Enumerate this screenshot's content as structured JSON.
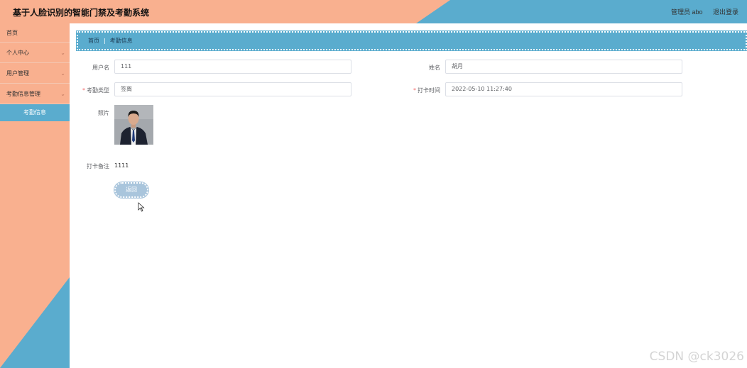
{
  "header": {
    "title": "基于人脸识别的智能门禁及考勤系统",
    "user_label": "管理员 abo",
    "logout_label": "退出登录"
  },
  "sidebar": {
    "items": [
      {
        "label": "首页",
        "has_chevron": false
      },
      {
        "label": "个人中心",
        "has_chevron": true
      },
      {
        "label": "用户管理",
        "has_chevron": true
      },
      {
        "label": "考勤信息管理",
        "has_chevron": true
      }
    ],
    "subitem": {
      "label": "考勤信息"
    }
  },
  "breadcrumb": {
    "home": "首页",
    "separator": "|",
    "current": "考勤信息"
  },
  "form": {
    "username": {
      "label": "用户名",
      "value": "111"
    },
    "name": {
      "label": "姓名",
      "value": "胡月"
    },
    "attendance_type": {
      "label": "考勤类型",
      "value": "签离",
      "required_mark": "*"
    },
    "clock_time": {
      "label": "打卡时间",
      "value": "2022-05-10 11:27:40",
      "required_mark": "*"
    },
    "photo": {
      "label": "照片"
    },
    "remark": {
      "label": "打卡备注",
      "value": "1111"
    }
  },
  "back_button": {
    "label": "返回"
  },
  "watermark": "CSDN @ck3026",
  "colors": {
    "salmon": "#f9b08f",
    "blue": "#5aacce",
    "button": "#a9c5dc",
    "required": "#f56c6c"
  },
  "icons": {
    "chevron": "chevron-down-icon",
    "cursor": "mouse-pointer-icon",
    "photo": "person-photo"
  }
}
